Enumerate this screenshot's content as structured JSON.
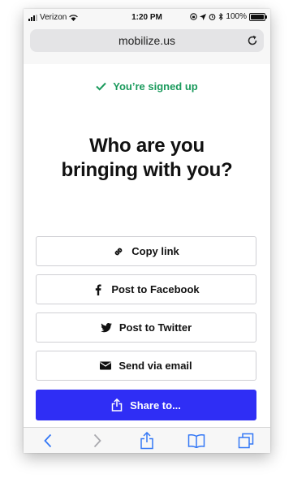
{
  "status_bar": {
    "carrier": "Verizon",
    "time": "1:20 PM",
    "battery": "100%",
    "battery_level": 1.0
  },
  "browser": {
    "url": "mobilize.us"
  },
  "page": {
    "signed_up": "You’re signed up",
    "heading_line1": "Who are you",
    "heading_line2": "bringing with you?",
    "buttons": [
      {
        "label": "Copy link",
        "icon": "link-icon"
      },
      {
        "label": "Post to Facebook",
        "icon": "facebook-icon"
      },
      {
        "label": "Post to Twitter",
        "icon": "twitter-icon"
      },
      {
        "label": "Send via email",
        "icon": "envelope-icon"
      },
      {
        "label": "Share to...",
        "icon": "share-icon"
      }
    ]
  },
  "colors": {
    "accent": "#2f2ef5",
    "success": "#1a9a5c",
    "ios_blue": "#3478f6"
  },
  "toolbar_icons": [
    "back-icon",
    "forward-icon",
    "share-icon",
    "bookmarks-icon",
    "tabs-icon"
  ]
}
